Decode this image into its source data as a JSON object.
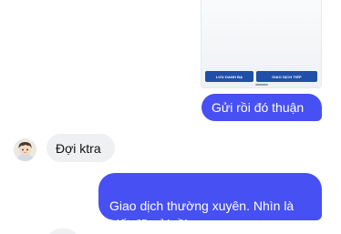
{
  "shared_image": {
    "button_save_contact": "LƯU DANH BẠ",
    "button_next_transaction": "GIAO DỊCH TIẾP"
  },
  "messages": [
    {
      "side": "sent",
      "text": "Gửi rồi đó thuận"
    },
    {
      "side": "received",
      "sender_avatar": "avatar-cartoon-boy",
      "text": "Đợi ktra"
    },
    {
      "side": "sent",
      "text": "Giao dịch thường xuyên. Nhìn là\nbiết đã gửi rồi."
    }
  ],
  "colors": {
    "sent_bubble": "#4750f2",
    "received_bubble": "#eef0f2",
    "image_button": "#1f4fa8"
  }
}
